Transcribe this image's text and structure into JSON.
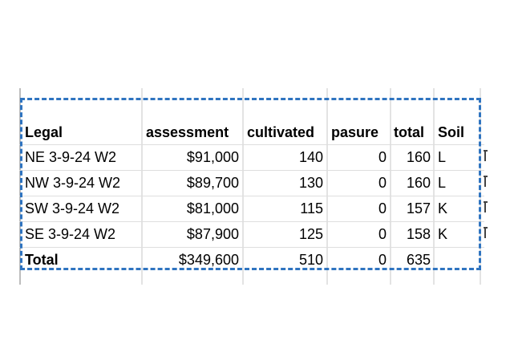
{
  "table": {
    "headers": [
      "Legal",
      "assessment",
      "cultivated",
      "pasure",
      "total",
      "Soil"
    ],
    "rows": [
      [
        "NE 3-9-24 W2",
        "$91,000",
        "140",
        "0",
        "160",
        "L"
      ],
      [
        "NW 3-9-24 W2",
        "$89,700",
        "130",
        "0",
        "160",
        "L"
      ],
      [
        "SW 3-9-24 W2",
        "$81,000",
        "115",
        "0",
        "157",
        "K"
      ],
      [
        "SE 3-9-24 W2",
        "$87,900",
        "125",
        "0",
        "158",
        "K"
      ]
    ],
    "total_row": [
      "Total",
      "$349,600",
      "510",
      "0",
      "635",
      ""
    ]
  },
  "colors": {
    "selection_border": "#2f74c0",
    "gridline": "#dedede"
  }
}
